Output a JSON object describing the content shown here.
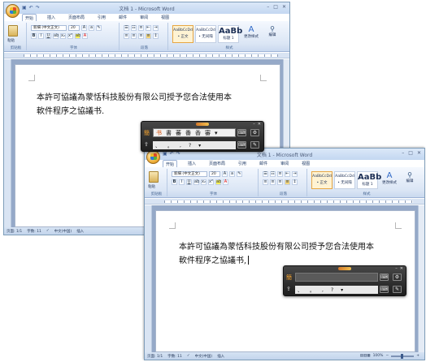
{
  "word": {
    "title": "文档 1 - Microsoft Word",
    "qat_icons": [
      "save-icon",
      "undo-icon",
      "redo-icon"
    ],
    "window_buttons": [
      "–",
      "□",
      "✕"
    ],
    "tabs": [
      "开始",
      "插入",
      "页面布局",
      "引用",
      "邮件",
      "审阅",
      "视图"
    ],
    "ribbon": {
      "paste_label": "粘贴",
      "font_name": "新細 (中文正文)",
      "font_size": "20",
      "clipboard_label": "剪贴板",
      "font_label": "字体",
      "paragraph_label": "段落",
      "styles_label": "样式",
      "styles": [
        {
          "sample": "AaBbCcDd",
          "name": "• 正文"
        },
        {
          "sample": "AaBbCcDd",
          "name": "• 无间隔"
        },
        {
          "sample": "AaBb",
          "name": "标题 1"
        }
      ],
      "change_styles": "更改样式",
      "editing": "编辑"
    },
    "status": {
      "page": "页面: 1/1",
      "words": "字数: 11",
      "lang": "中文(中国)",
      "mode": "插入",
      "zoom": "100%"
    }
  },
  "back_doc": {
    "line1": "本許可協議為蒙恬科技股份有限公司授予您合法使用本",
    "line2": "軟件程序之協議书."
  },
  "front_doc": {
    "line1": "本許可協議為蒙恬科技股份有限公司授予您合法使用本",
    "line2": "軟件程序之協議书,"
  },
  "ime_back": {
    "mode": "簡",
    "candidates": [
      "书",
      "書",
      "蕃",
      "番",
      "香",
      "審",
      "▾"
    ],
    "punct": [
      "、",
      "。",
      ",",
      "?",
      "▾"
    ],
    "tool_icons": [
      "keyboard-icon",
      "gear-icon",
      "pen-icon"
    ]
  },
  "ime_front": {
    "mode": "簡",
    "punct": [
      "、",
      "。",
      ",",
      "?",
      "▾"
    ],
    "tool_icons": [
      "keyboard-icon",
      "gear-icon",
      "pen-icon"
    ]
  }
}
